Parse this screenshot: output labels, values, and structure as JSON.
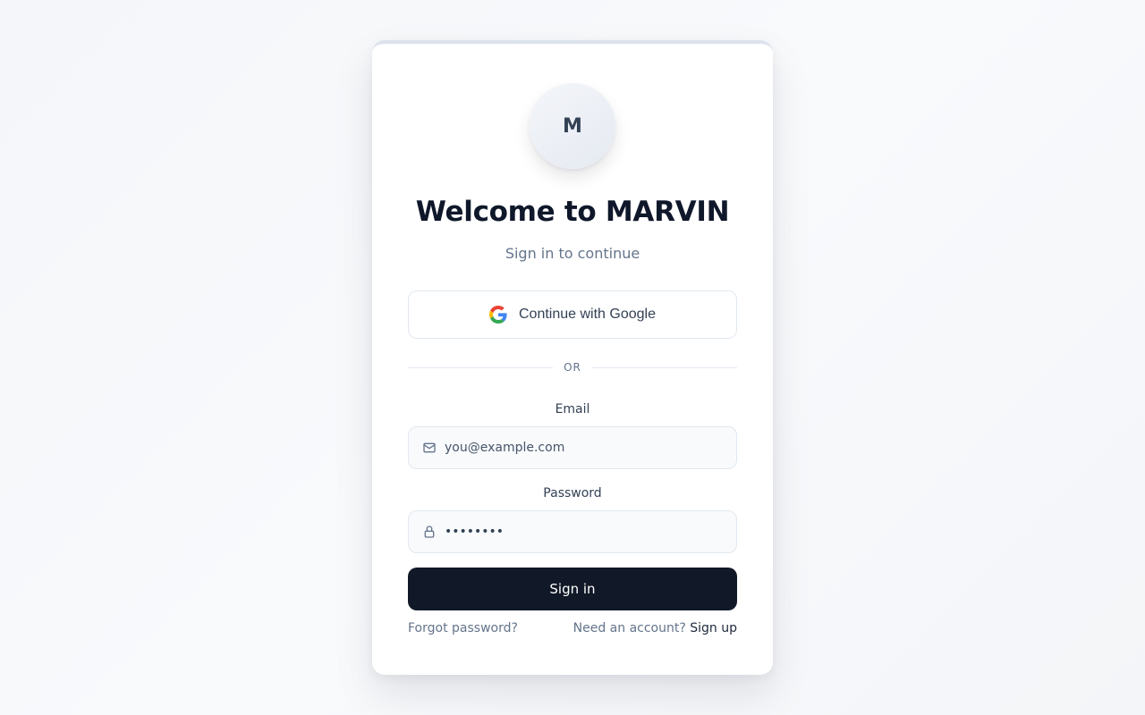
{
  "brand": {
    "initial": "M",
    "title": "Welcome to MARVIN",
    "subtitle": "Sign in to continue"
  },
  "oauth": {
    "google_label": "Continue with Google",
    "icon": "google-icon"
  },
  "divider": {
    "text": "OR"
  },
  "email": {
    "label": "Email",
    "placeholder": "you@example.com",
    "value": "",
    "icon": "mail-icon"
  },
  "password": {
    "label": "Password",
    "value": "password",
    "icon": "lock-icon"
  },
  "actions": {
    "signin_label": "Sign in",
    "forgot_label": "Forgot password?",
    "need_account_label": "Need an account?",
    "signup_label": "Sign up"
  },
  "colors": {
    "primary_button": "#111827",
    "title_text": "#0f172a",
    "muted_text": "#64748b"
  }
}
